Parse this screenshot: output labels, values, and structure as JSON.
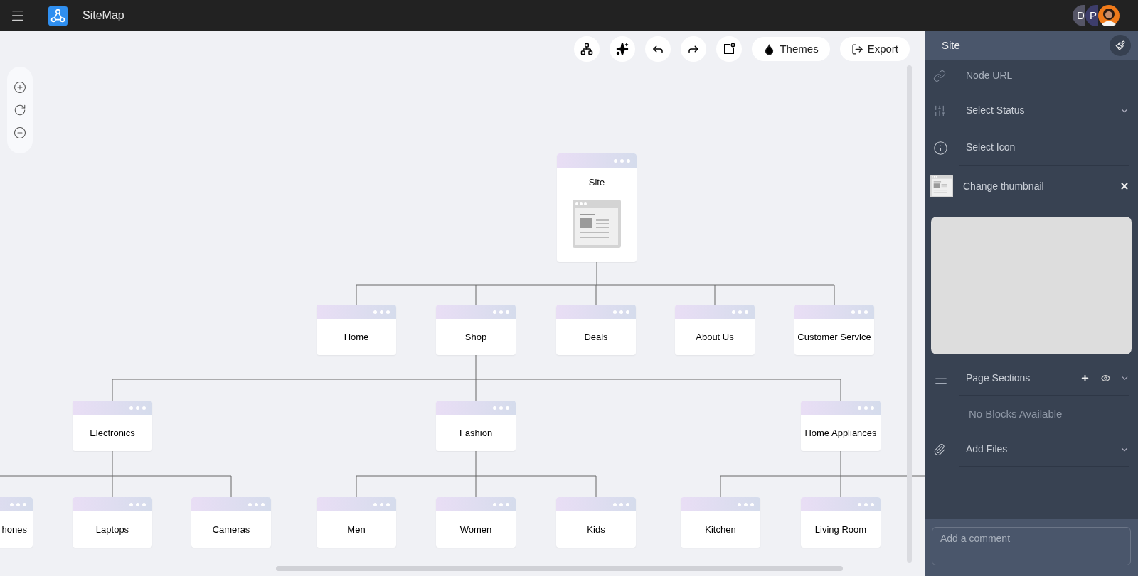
{
  "app": {
    "title": "SiteMap"
  },
  "avatars": [
    {
      "kind": "letter",
      "label": "D"
    },
    {
      "kind": "letter",
      "label": "P"
    },
    {
      "kind": "photo"
    }
  ],
  "toolbar": {
    "text_buttons": [
      "Themes",
      "Export"
    ]
  },
  "sitemap": {
    "label": "Site",
    "kind": "thumbnail",
    "children": [
      {
        "label": "Home",
        "kind": "page"
      },
      {
        "label": "Shop",
        "kind": "page",
        "children": [
          {
            "label": "Electronics",
            "kind": "page",
            "children": [
              {
                "label": "hones",
                "kind": "page"
              },
              {
                "label": "Laptops",
                "kind": "page"
              },
              {
                "label": "Cameras",
                "kind": "page"
              }
            ]
          },
          {
            "label": "Fashion",
            "kind": "page",
            "children": [
              {
                "label": "Men",
                "kind": "page"
              },
              {
                "label": "Women",
                "kind": "page"
              },
              {
                "label": "Kids",
                "kind": "page"
              }
            ]
          },
          {
            "label": "Home Appliances",
            "kind": "page",
            "children": [
              {
                "label": "Kitchen",
                "kind": "page"
              },
              {
                "label": "Living Room",
                "kind": "page"
              }
            ]
          }
        ]
      },
      {
        "label": "Deals",
        "kind": "page"
      },
      {
        "label": "About Us",
        "kind": "page"
      },
      {
        "label": "Customer Service",
        "kind": "page"
      }
    ]
  },
  "panel": {
    "title": "Site",
    "node_url": {
      "placeholder": "Node URL"
    },
    "status": {
      "label": "Select Status"
    },
    "icon": {
      "label": "Select Icon"
    },
    "thumbnail": {
      "label": "Change thumbnail"
    },
    "page_sections": {
      "label": "Page Sections",
      "empty_text": "No Blocks Available"
    },
    "files": {
      "label": "Add Files"
    },
    "comment": {
      "placeholder": "Add a comment"
    }
  }
}
